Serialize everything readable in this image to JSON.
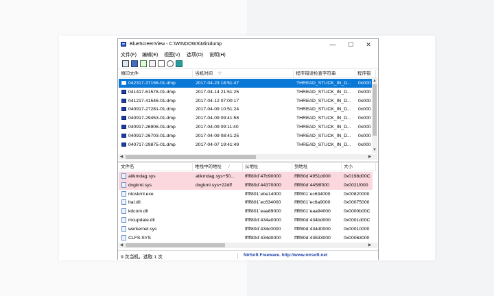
{
  "window": {
    "title": "BlueScreenView  -  C:\\WINDOWS\\Minidump",
    "minimize": "—",
    "maximize": "☐",
    "close": "✕"
  },
  "menu": [
    "文件(F)",
    "编辑(E)",
    "视图(V)",
    "选项(O)",
    "说明(H)"
  ],
  "toolbar": [
    "properties-icon",
    "save-icon",
    "copy-icon",
    "html-report-icon",
    "options-icon",
    "find-icon",
    "exit-icon"
  ],
  "dumps": {
    "columns": [
      "傾印文件",
      "当机时间",
      "程序错误检查字符串",
      "程序错"
    ],
    "sort_indicator": "▽",
    "rows": [
      {
        "file": "042317-37156-01.dmp",
        "time": "2017-04-23 18:51:47",
        "bug": "THREAD_STUCK_IN_D...",
        "code": "0x000"
      },
      {
        "file": "041417-61578-01.dmp",
        "time": "2017-04-14 21:51:25",
        "bug": "THREAD_STUCK_IN_D...",
        "code": "0x000"
      },
      {
        "file": "041217-41546-01.dmp",
        "time": "2017-04-12 07:00:17",
        "bug": "THREAD_STUCK_IN_D...",
        "code": "0x000"
      },
      {
        "file": "040917-27281-01.dmp",
        "time": "2017-04-09 10:51:24",
        "bug": "THREAD_STUCK_IN_D...",
        "code": "0x000"
      },
      {
        "file": "040917-29453-01.dmp",
        "time": "2017-04-09 09:41:58",
        "bug": "THREAD_STUCK_IN_D...",
        "code": "0x000"
      },
      {
        "file": "040917-26906-01.dmp",
        "time": "2017-04-09 09:11:40",
        "bug": "THREAD_STUCK_IN_D...",
        "code": "0x000"
      },
      {
        "file": "040917-26703-01.dmp",
        "time": "2017-04-09 08:41:25",
        "bug": "THREAD_STUCK_IN_D...",
        "code": "0x000"
      },
      {
        "file": "040717-29875-01.dmp",
        "time": "2017-04-07 19:41:49",
        "bug": "THREAD_STUCK_IN_D...",
        "code": "0x000"
      }
    ]
  },
  "modules": {
    "columns": [
      "文件名",
      "堆栈中的地址",
      "从地址",
      "到地址",
      "大小"
    ],
    "sort_indicator": "/",
    "rows": [
      {
        "name": "atikmdag.sys",
        "stack": "atikmdag.sys+50...",
        "from": "fffff80d`47b90000",
        "to": "fffff80d`4951d000",
        "size": "0x0198d00C"
      },
      {
        "name": "dxgkrnl.sys",
        "stack": "dxgkrnl.sys+22dff",
        "from": "fffff80d`44370000",
        "to": "fffff80d`4458f000",
        "size": "0x0021f000"
      },
      {
        "name": "ntoskrnl.exe",
        "stack": "",
        "from": "fffff801`ebe14000",
        "to": "fffff801`ec634000",
        "size": "0x00820000"
      },
      {
        "name": "hal.dll",
        "stack": "",
        "from": "fffff801`ec634000",
        "to": "fffff801`ec6a9000",
        "size": "0x00075000"
      },
      {
        "name": "kdcom.dll",
        "stack": "",
        "from": "fffff801`eaa89000",
        "to": "fffff801`eaa94000",
        "size": "0x0000b00C"
      },
      {
        "name": "mcupdate.dll",
        "stack": "",
        "from": "fffff80d`434a0000",
        "to": "fffff80d`434bd000",
        "size": "0x0001d00C"
      },
      {
        "name": "werkernel.sys",
        "stack": "",
        "from": "fffff80d`434c0000",
        "to": "fffff80d`434d0000",
        "size": "0x00010000"
      },
      {
        "name": "CLFS.SYS",
        "stack": "",
        "from": "fffff80d`434d0000",
        "to": "fffff80d`43533000",
        "size": "0x00063000"
      }
    ]
  },
  "status": {
    "summary": "9 次当机，选取 1 次",
    "link": "NirSoft Freeware.  http://www.nirsoft.net"
  },
  "colors": {
    "selection": "#0a78d7",
    "highlight": "#fbd8de",
    "link": "#1a3ea8"
  }
}
